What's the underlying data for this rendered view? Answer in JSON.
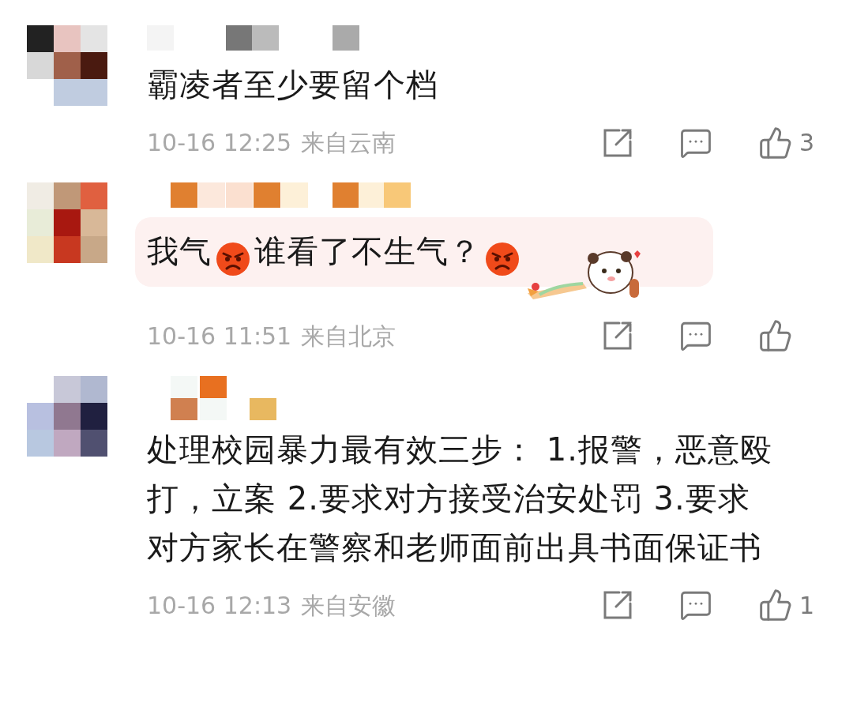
{
  "comments": [
    {
      "highlighted": false,
      "parts": [
        {
          "kind": "text",
          "text": "霸凌者至少要留个档"
        }
      ],
      "time": "10-16 12:25",
      "location": "来自云南",
      "likes": "3"
    },
    {
      "highlighted": true,
      "parts": [
        {
          "kind": "text",
          "text": "我气"
        },
        {
          "kind": "emoji"
        },
        {
          "kind": "text",
          "text": "谁看了不生气？"
        },
        {
          "kind": "emoji"
        },
        {
          "kind": "sticker"
        }
      ],
      "time": "10-16 11:51",
      "location": "来自北京"
    },
    {
      "highlighted": false,
      "parts": [
        {
          "kind": "text",
          "text": "处理校园暴力最有效三步： 1.报警，恶意殴打，立案 2.要求对方接受治安处罚 3.要求对方家长在警察和老师面前出具书面保证书"
        }
      ],
      "time": "10-16 12:13",
      "location": "来自安徽",
      "likes": "1"
    }
  ]
}
